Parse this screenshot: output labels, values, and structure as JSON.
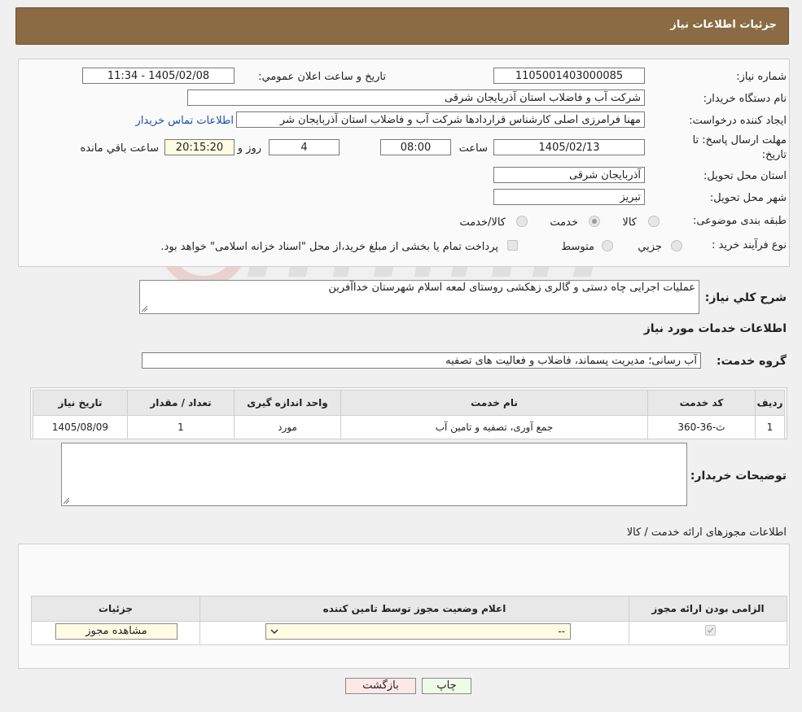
{
  "header": {
    "title": "جزئیات اطلاعات نیاز"
  },
  "form": {
    "need_number_label": "شماره نیاز:",
    "need_number": "1105001403000085",
    "announce_label": "تاریخ و ساعت اعلان عمومي:",
    "announce_value": "1405/02/08 - 11:34",
    "buyer_org_label": "نام دستگاه خریدار:",
    "buyer_org": "شرکت آب و فاضلاب استان آذربایجان شرقی",
    "requester_label": "ایجاد کننده درخواست:",
    "requester": "مهنا فرامرزی اصلی کارشناس قراردادها شرکت آب و فاضلاب استان آذربایجان شر",
    "contact_link": "اطلاعات تماس خریدار",
    "deadline_label_1": "مهلت ارسال پاسخ: تا",
    "deadline_label_2": "تاریخ:",
    "deadline_date": "1405/02/13",
    "time_label": "ساعت",
    "deadline_time": "08:00",
    "days_value": "4",
    "days_label": "روز و",
    "remaining_time": "20:15:20",
    "remaining_label": "ساعت باقي مانده",
    "province_label": "استان محل تحویل:",
    "province": "آذربایجان شرقی",
    "city_label": "شهر محل تحویل:",
    "city": "تبریز",
    "category_label": "طبقه بندی موضوعی:",
    "category_options": [
      "کالا",
      "خدمت",
      "کالا/خدمت"
    ],
    "process_label": "نوع فرآیند خرید :",
    "process_options": [
      "جزیي",
      "متوسط"
    ],
    "payment_note": "پرداخت تمام یا بخشی از مبلغ خرید،از محل \"اسناد خزانه اسلامی\" خواهد بود."
  },
  "description": {
    "label": "شرح کلي نیاز:",
    "text": "عملیات اجرایی چاه دستی و گالری زهکشی روستای لمعه اسلام شهرستان خداآفرین"
  },
  "services": {
    "title": "اطلاعات خدمات مورد نیاز",
    "group_label": "گروه خدمت:",
    "group_value": "آب رسانی؛ مدیریت پسماند، فاضلاب و فعالیت های تصفیه",
    "columns": [
      "ردیف",
      "کد خدمت",
      "نام خدمت",
      "واحد اندازه گیری",
      "تعداد / مقدار",
      "تاریخ نیاز"
    ],
    "rows": [
      [
        "1",
        "ث-36-360",
        "جمع آوری، تصفیه و تامین آب",
        "مورد",
        "1",
        "1405/08/09"
      ]
    ]
  },
  "buyer_notes": {
    "label": "توضیحات خریدار:"
  },
  "permits": {
    "title": "اطلاعات مجوزهای ارائه خدمت / کالا",
    "columns": [
      "الزامی بودن ارائه مجوز",
      "اعلام وضعیت مجوز توسط تامین کننده",
      "جزئیات"
    ],
    "select_value": "--",
    "view_button": "مشاهده مجوز"
  },
  "footer": {
    "print_button": "چاپ",
    "back_button": "بازگشت"
  },
  "colors": {
    "header_bg": "#8b6b43",
    "link": "#1a4ea8"
  }
}
